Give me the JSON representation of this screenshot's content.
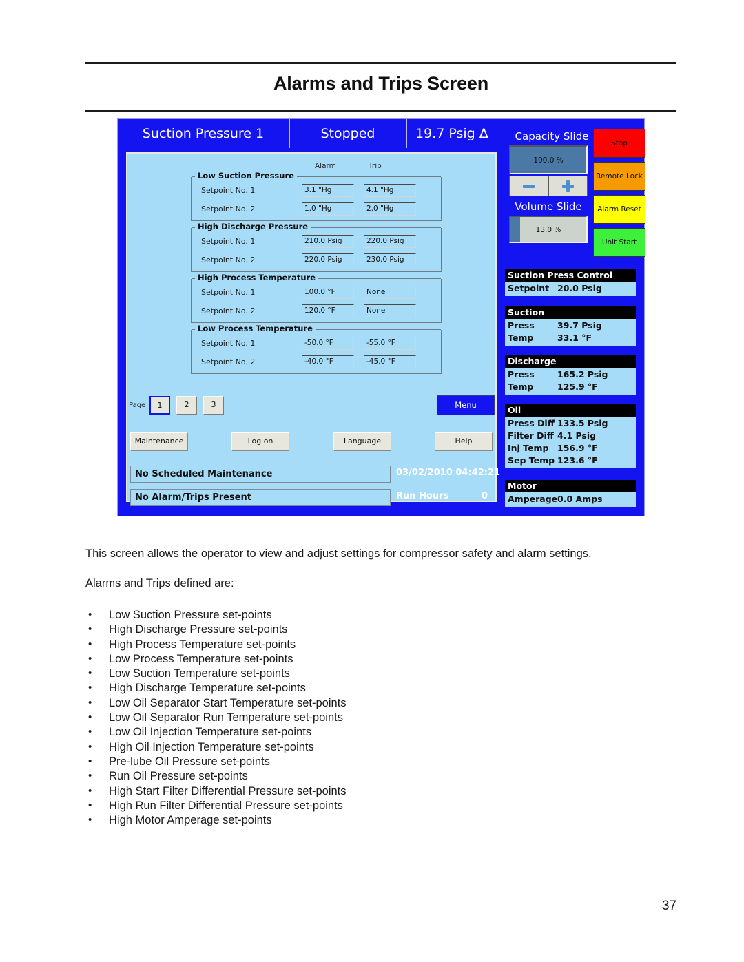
{
  "document": {
    "title": "Alarms and Trips Screen",
    "page_number": "37",
    "intro_paragraph": "This screen allows the operator to view and adjust settings for compressor safety and alarm settings.",
    "list_intro": "Alarms and Trips defined are:",
    "bullets": [
      "Low Suction Pressure set-points",
      "High Discharge Pressure set-points",
      "High Process Temperature set-points",
      "Low Process Temperature set-points",
      "Low Suction Temperature set-points",
      "High Discharge Temperature set-points",
      "Low Oil Separator Start Temperature set-points",
      "Low Oil Separator Run Temperature set-points",
      "Low Oil Injection Temperature set-points",
      "High Oil Injection Temperature set-points",
      "Pre-lube Oil Pressure set-points",
      "Run Oil Pressure set-points",
      "High Start Filter Differential Pressure set-points",
      "High Run Filter Differential Pressure set-points",
      "High Motor Amperage set-points"
    ]
  },
  "hmi": {
    "topbar": {
      "channel": "Suction Pressure 1",
      "state": "Stopped",
      "value": "19.7 Psig Δ"
    },
    "columns": {
      "alarm": "Alarm",
      "trip": "Trip"
    },
    "groups": [
      {
        "title": "Low Suction Pressure",
        "rows": [
          {
            "label": "Setpoint No. 1",
            "alarm": "3.1 \"Hg",
            "trip": "4.1 \"Hg"
          },
          {
            "label": "Setpoint No. 2",
            "alarm": "1.0 \"Hg",
            "trip": "2.0 \"Hg"
          }
        ]
      },
      {
        "title": "High Discharge Pressure",
        "rows": [
          {
            "label": "Setpoint No. 1",
            "alarm": "210.0 Psig",
            "trip": "220.0 Psig"
          },
          {
            "label": "Setpoint No. 2",
            "alarm": "220.0 Psig",
            "trip": "230.0 Psig"
          }
        ]
      },
      {
        "title": "High Process Temperature",
        "rows": [
          {
            "label": "Setpoint No. 1",
            "alarm": "100.0 °F",
            "trip": "None"
          },
          {
            "label": "Setpoint No. 2",
            "alarm": "120.0 °F",
            "trip": "None"
          }
        ]
      },
      {
        "title": "Low Process Temperature",
        "rows": [
          {
            "label": "Setpoint No. 1",
            "alarm": "-50.0 °F",
            "trip": "-55.0 °F"
          },
          {
            "label": "Setpoint No. 2",
            "alarm": "-40.0 °F",
            "trip": "-45.0 °F"
          }
        ]
      }
    ],
    "pagebar": {
      "label": "Page",
      "pages": [
        "1",
        "2",
        "3"
      ],
      "selected": "1",
      "menu_label": "Menu"
    },
    "function_buttons": [
      "Maintenance",
      "Log on",
      "Language",
      "Help"
    ],
    "status": {
      "maintenance": "No Scheduled Maintenance",
      "alarm": "No Alarm/Trips Present",
      "datetime": "03/02/2010  04:42:21",
      "run_hours_label": "Run Hours",
      "run_hours_value": "0"
    },
    "capacity_slide": {
      "title": "Capacity Slide",
      "value": "100.0 %",
      "percent": 100
    },
    "volume_slide": {
      "title": "Volume Slide",
      "value": "13.0 %",
      "percent": 13
    },
    "stepper": {
      "minus": "minus-icon",
      "plus": "plus-icon"
    },
    "action_buttons": [
      {
        "label": "Stop",
        "color": "#ff0000"
      },
      {
        "label": "Remote Lock",
        "color": "#f59b00"
      },
      {
        "label": "Alarm Reset",
        "color": "#ffff00"
      },
      {
        "label": "Unit Start",
        "color": "#3cf03c"
      }
    ],
    "panels": [
      {
        "header": "Suction Press Control",
        "rows": [
          {
            "key": "Setpoint",
            "value": "20.0 Psig"
          }
        ]
      },
      {
        "header": "Suction",
        "rows": [
          {
            "key": "Press",
            "value": "39.7 Psig"
          },
          {
            "key": "Temp",
            "value": "33.1 °F"
          }
        ]
      },
      {
        "header": "Discharge",
        "rows": [
          {
            "key": "Press",
            "value": "165.2 Psig"
          },
          {
            "key": "Temp",
            "value": "125.9 °F"
          }
        ]
      },
      {
        "header": "Oil",
        "rows": [
          {
            "key": "Press Diff",
            "value": "133.5 Psig"
          },
          {
            "key": "Filter Diff",
            "value": "4.1 Psig"
          },
          {
            "key": "Inj Temp",
            "value": "156.9 °F"
          },
          {
            "key": "Sep Temp",
            "value": "123.6 °F"
          }
        ]
      },
      {
        "header": "Motor",
        "rows": [
          {
            "key": "Amperage",
            "value": "0.0 Amps"
          }
        ]
      }
    ]
  }
}
